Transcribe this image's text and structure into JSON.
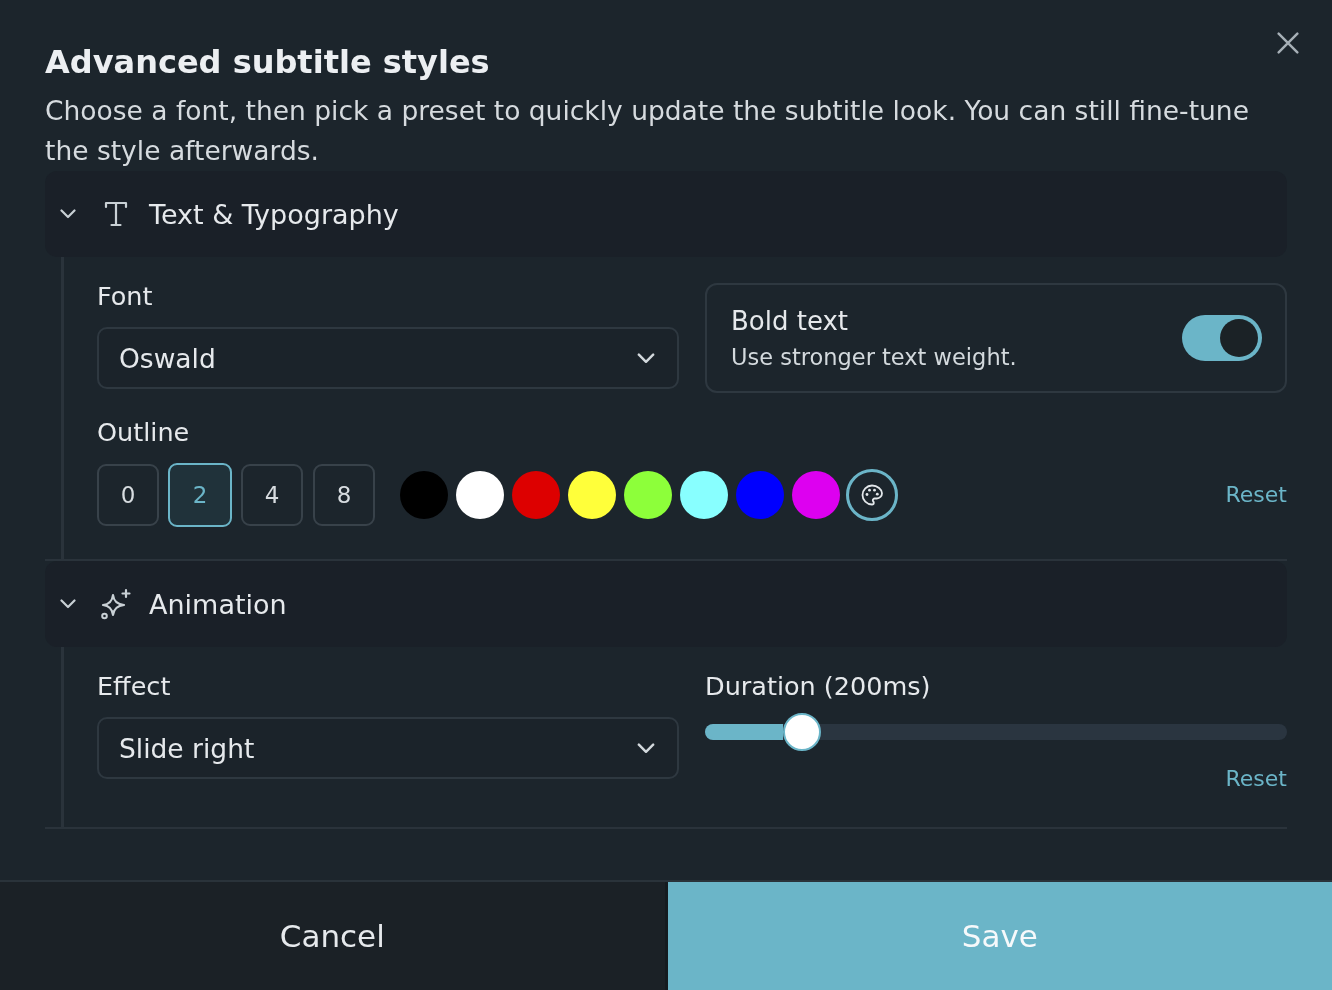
{
  "dialog": {
    "title": "Advanced subtitle styles",
    "description": "Choose a font, then pick a preset to quickly update the subtitle look. You can still fine-tune the style afterwards."
  },
  "sections": [
    {
      "kind": "typography",
      "title": "Text & Typography",
      "expanded": true,
      "font": {
        "label": "Font",
        "value": "Oswald"
      },
      "bold_text": {
        "title": "Bold text",
        "description": "Use stronger text weight.",
        "on": true
      },
      "outline": {
        "label": "Outline",
        "widths": [
          {
            "label": "0",
            "selected": false
          },
          {
            "label": "2",
            "selected": true
          },
          {
            "label": "4",
            "selected": false
          },
          {
            "label": "8",
            "selected": false
          }
        ],
        "colors": [
          {
            "color": "#000000"
          },
          {
            "color": "#ffffff"
          },
          {
            "color": "#dd0000"
          },
          {
            "color": "#ffff3a"
          },
          {
            "color": "#8dff3a"
          },
          {
            "color": "#88ffff"
          },
          {
            "color": "#0000ff"
          },
          {
            "color": "#dd00f0"
          }
        ],
        "reset": "Reset"
      }
    },
    {
      "kind": "animation",
      "title": "Animation",
      "expanded": true,
      "effect": {
        "label": "Effect",
        "value": "Slide right"
      },
      "duration": {
        "label": "Duration (200ms)",
        "level": 0.167,
        "reset": "Reset"
      }
    }
  ],
  "buttons": [
    {
      "kind": "secondary",
      "label": "Cancel"
    },
    {
      "kind": "primary",
      "label": "Save"
    }
  ]
}
